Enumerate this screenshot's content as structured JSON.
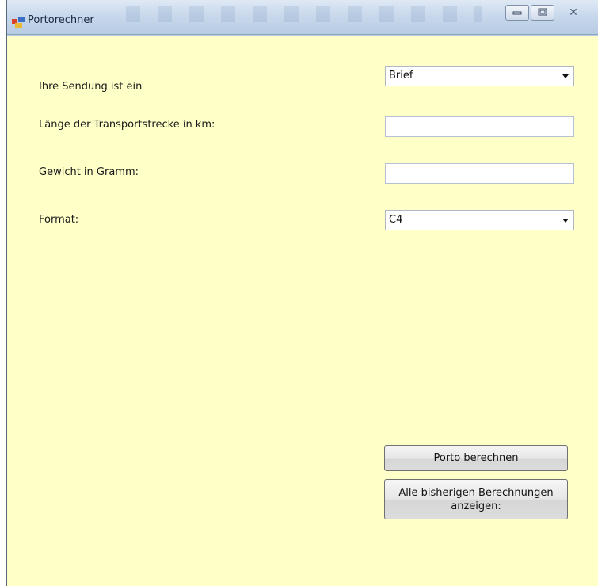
{
  "window": {
    "title": "Portorechner",
    "controls": {
      "minimize_icon": "minimize-icon",
      "maximize_icon": "maximize-icon",
      "close_glyph": "✕"
    }
  },
  "form": {
    "sendung_label": "Ihre Sendung ist ein",
    "sendung_value": "Brief",
    "laenge_label": "Länge der Transportstrecke in km:",
    "laenge_value": "",
    "gewicht_label": "Gewicht in Gramm:",
    "gewicht_value": "",
    "format_label": "Format:",
    "format_value": "C4"
  },
  "buttons": {
    "berechnen": "Porto berechnen",
    "alle_anzeigen": "Alle bisherigen Berechnungen anzeigen:"
  },
  "colors": {
    "client_background": "#ffffc8",
    "titlebar": "#c9d9ec"
  }
}
